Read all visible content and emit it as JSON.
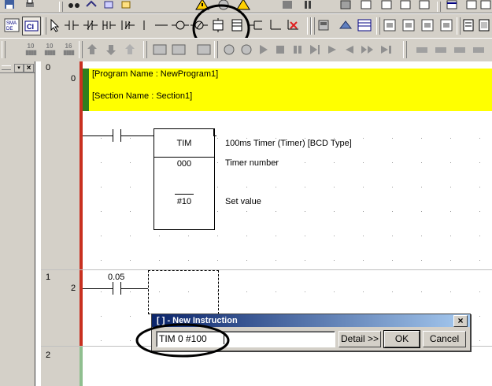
{
  "toolbar3": {
    "zoom_buttons": [
      "10",
      "10",
      "16"
    ]
  },
  "left_pane": {
    "close_glyph": "×"
  },
  "ladder": {
    "rows": [
      {
        "rung": "0",
        "step": "0"
      },
      {
        "rung": "1",
        "step": "2"
      },
      {
        "rung": "2",
        "step": ""
      }
    ],
    "program_name": "[Program Name : NewProgram1]",
    "section_name": "[Section Name : Section1]",
    "timer_block": {
      "title": "TIM",
      "operand1": "000",
      "operand2": "#10",
      "comment_title": "100ms Timer (Timer) [BCD Type]",
      "comment_operand1": "Timer number",
      "comment_operand2": "Set value"
    },
    "contact2_address": "0.05"
  },
  "dialog": {
    "title": "[ ] - New Instruction",
    "input_value": "TIM 0 #100",
    "detail_label": "Detail >>",
    "ok_label": "OK",
    "cancel_label": "Cancel",
    "close_glyph": "×"
  },
  "colors": {
    "section_header_bg": "#ffff00",
    "section_marker": "#2e7d1e",
    "power_rail": "#c83020",
    "title_bar": "#0a246a",
    "annotation_ring": "#000000"
  }
}
